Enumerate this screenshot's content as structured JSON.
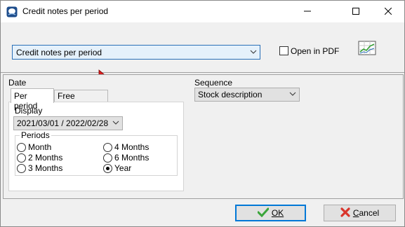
{
  "window": {
    "title": "Credit notes per period"
  },
  "top": {
    "report_value": "Credit notes per period",
    "open_pdf_label": "Open in PDF",
    "open_pdf_checked": false
  },
  "date": {
    "label": "Date",
    "tabs": [
      "Per period",
      "Free selection"
    ],
    "active_tab": "Per period",
    "display_label": "Display",
    "display_value": "2021/03/01 / 2022/02/28",
    "periods_label": "Periods",
    "periods": [
      {
        "label": "Month",
        "checked": false
      },
      {
        "label": "4 Months",
        "checked": false
      },
      {
        "label": "2 Months",
        "checked": false
      },
      {
        "label": "6 Months",
        "checked": false
      },
      {
        "label": "3 Months",
        "checked": false
      },
      {
        "label": "Year",
        "checked": true
      }
    ]
  },
  "sequence": {
    "label": "Sequence",
    "value": "Stock description"
  },
  "buttons": {
    "ok_label": "OK",
    "cancel_label": "Cancel"
  },
  "colors": {
    "accent": "#0078d7",
    "ok_check": "#3aa53a",
    "cancel_x": "#d9342b",
    "cursor": "#d81e1e"
  }
}
